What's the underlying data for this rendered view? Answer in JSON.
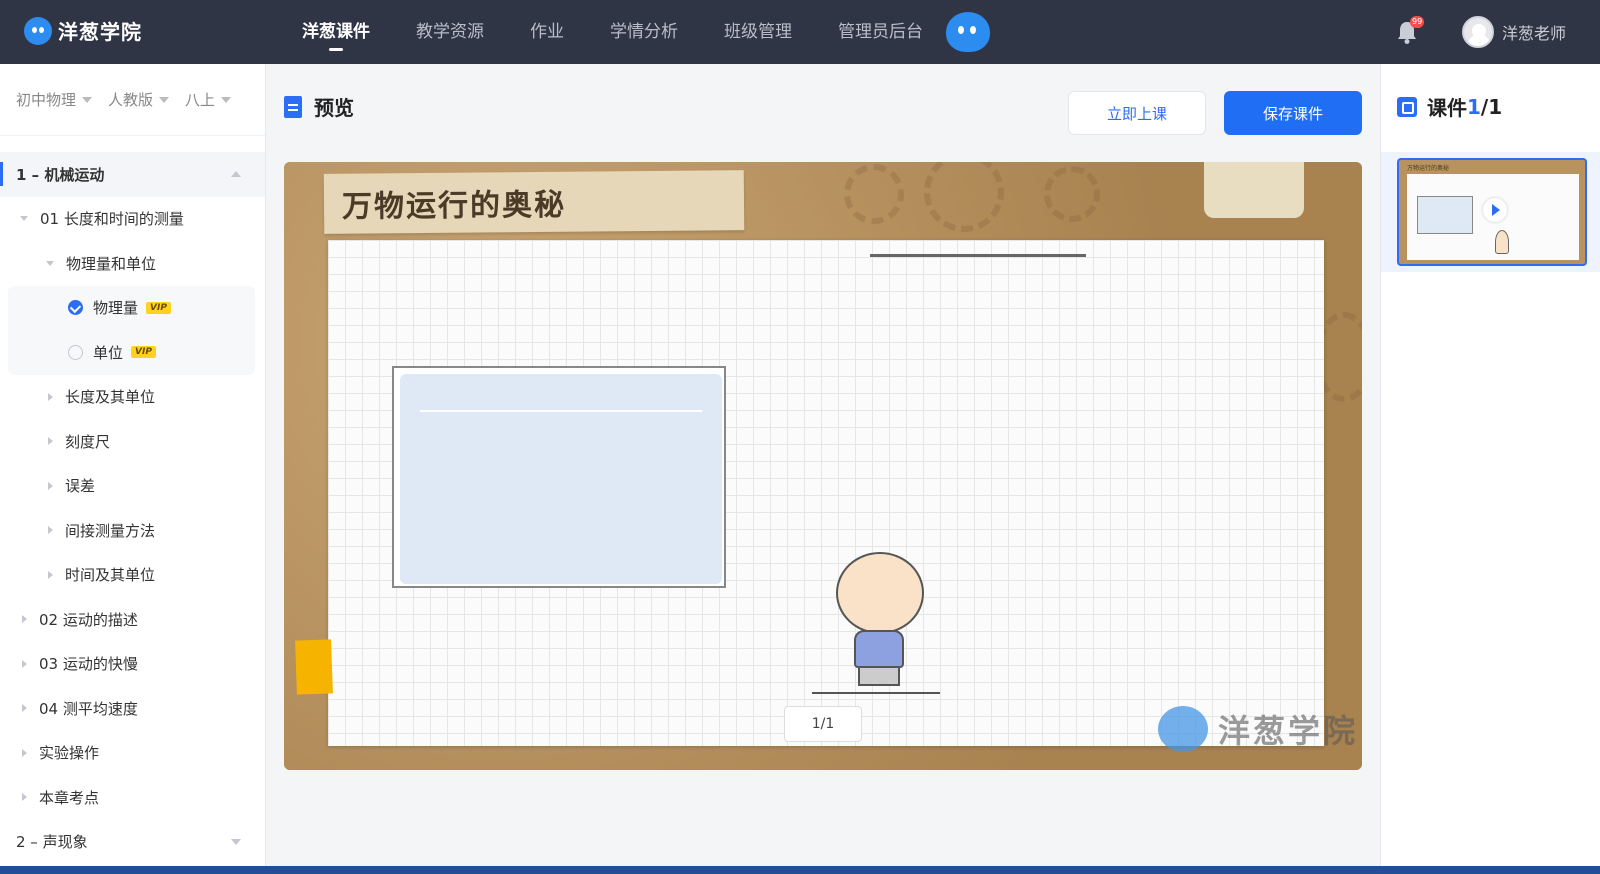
{
  "app": {
    "logo_text": "洋葱学院"
  },
  "nav": [
    {
      "label": "洋葱课件",
      "active": true
    },
    {
      "label": "教学资源",
      "active": false
    },
    {
      "label": "作业",
      "active": false
    },
    {
      "label": "学情分析",
      "active": false
    },
    {
      "label": "班级管理",
      "active": false
    },
    {
      "label": "管理员后台",
      "active": false
    }
  ],
  "user": {
    "name": "洋葱老师",
    "badge": "99"
  },
  "filters": [
    "初中物理",
    "人教版",
    "八上"
  ],
  "tree": {
    "chapter1": "1 – 机械运动",
    "section01": "01 长度和时间的测量",
    "sub_expanded": "物理量和单位",
    "leaf1": "物理量",
    "leaf2": "单位",
    "vip": "VIP",
    "subs": [
      "长度及其单位",
      "刻度尺",
      "误差",
      "间接测量方法",
      "时间及其单位"
    ],
    "sections": [
      "02 运动的描述",
      "03 运动的快慢",
      "04 测平均速度",
      "实验操作",
      "本章考点"
    ],
    "chapter2": "2 – 声现象"
  },
  "main": {
    "title": "预览",
    "start_class_label": "立即上课",
    "save_label": "保存课件"
  },
  "stage": {
    "title": "万物运行的奥秘",
    "page_counter": "1/1",
    "watermark": "洋葱学院"
  },
  "right_panel": {
    "title": "课件",
    "current": "1",
    "total": "/1",
    "thumb_label": "万物运行的奥秘"
  },
  "colors": {
    "accent": "#2d6cf5",
    "topbar": "#2f3545",
    "primary_button": "#1f6ef4"
  }
}
